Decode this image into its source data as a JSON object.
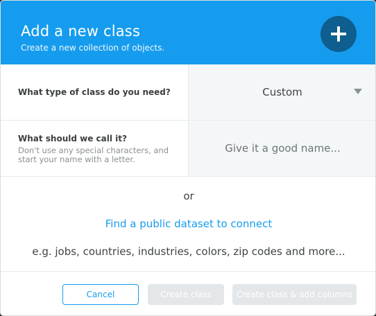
{
  "dialog": {
    "title": "Add a new class",
    "subtitle": "Create a new collection of objects.",
    "add_icon": "plus-icon"
  },
  "class_type": {
    "label": "What type of class do you need?",
    "value": "Custom",
    "caret_icon": "caret-down-icon"
  },
  "class_name": {
    "label": "What should we call it?",
    "help": "Don't use any special characters, and start your name with a letter.",
    "value": "",
    "placeholder": "Give it a good name..."
  },
  "alternative": {
    "or_text": "or",
    "link_text": "Find a public dataset to connect",
    "examples": "e.g. jobs, countries, industries, colors, zip codes and more..."
  },
  "footer": {
    "cancel_label": "Cancel",
    "create_label": "Create class",
    "create_add_label": "Create class & add columns"
  },
  "colors": {
    "header_bg": "#169cee",
    "add_button_bg": "#0e5f8f",
    "link": "#169cee",
    "disabled_button_bg": "#e3e7e9"
  }
}
